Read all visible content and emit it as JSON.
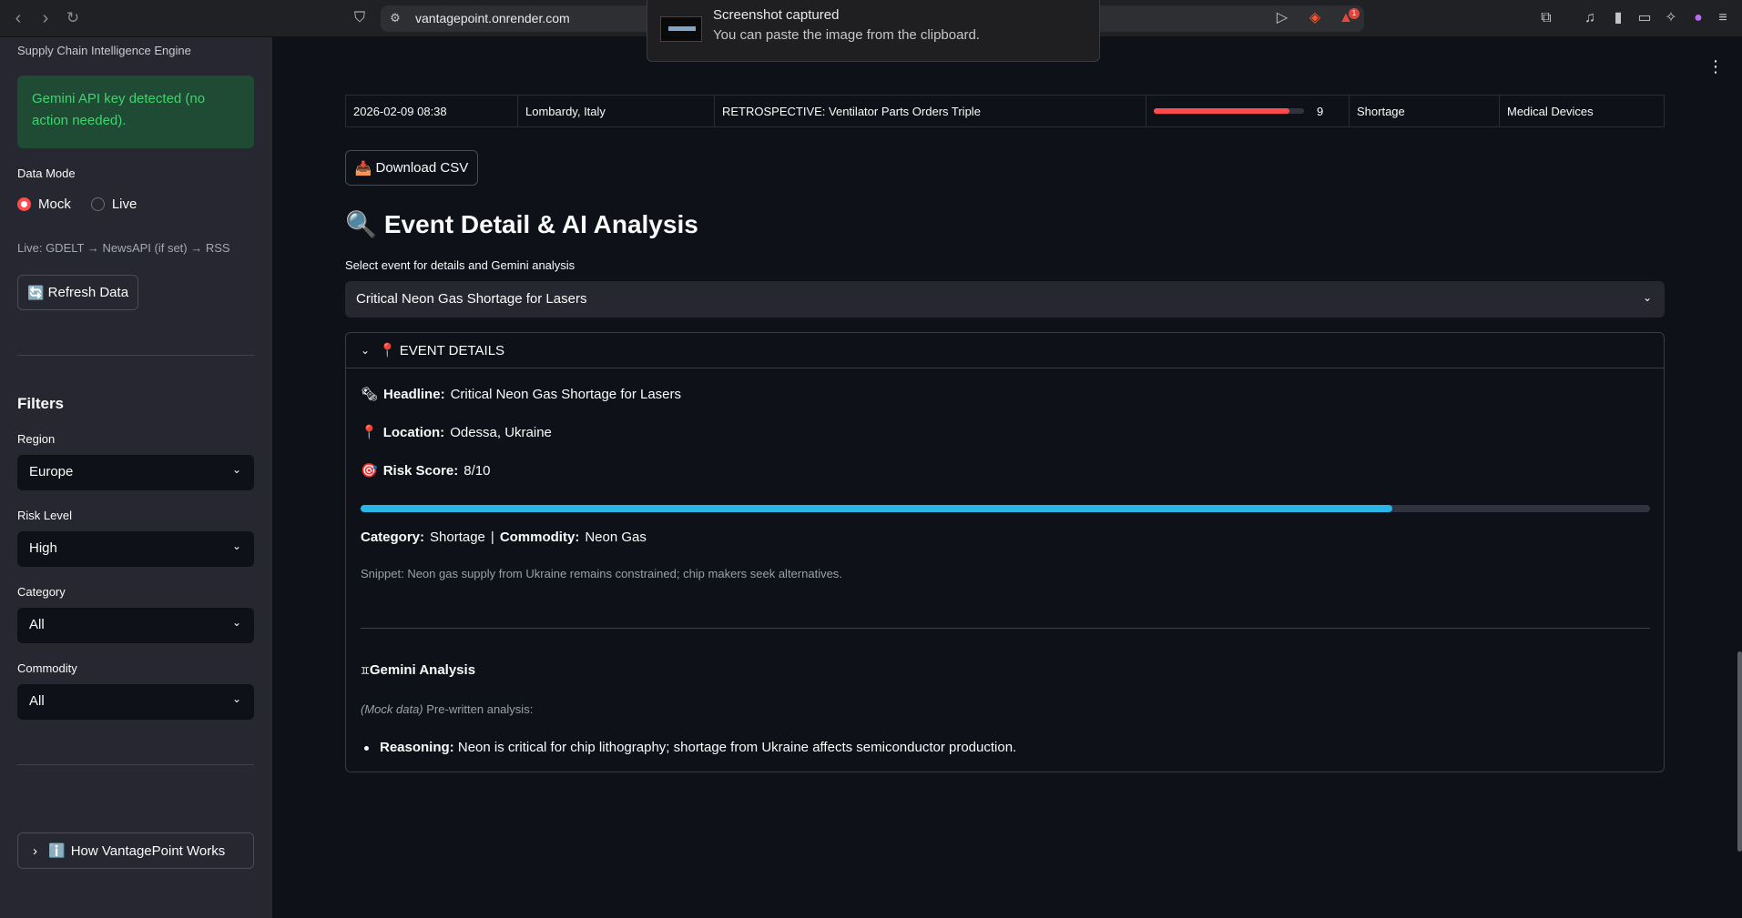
{
  "browser": {
    "url": "vantagepoint.onrender.com",
    "notification_count": "1"
  },
  "toast": {
    "title": "Screenshot captured",
    "subtitle": "You can paste the image from the clipboard."
  },
  "sidebar": {
    "tagline": "Supply Chain Intelligence Engine",
    "api_notice": "Gemini API key detected (no action needed).",
    "data_mode_label": "Data Mode",
    "mode_options": [
      "Mock",
      "Live"
    ],
    "mode_selected": "Mock",
    "live_caption": "Live: GDELT → NewsAPI (if set) → RSS",
    "refresh_icon": "🔄",
    "refresh_label": "Refresh Data",
    "filters_title": "Filters",
    "region_label": "Region",
    "region_value": "Europe",
    "risk_label": "Risk Level",
    "risk_value": "High",
    "category_label": "Category",
    "category_value": "All",
    "commodity_label": "Commodity",
    "commodity_value": "All",
    "how_icon": "ℹ️",
    "how_label": "How VantagePoint Works"
  },
  "table": {
    "row": {
      "timestamp": "2026-02-09 08:38",
      "location": "Lombardy, Italy",
      "headline": "RETROSPECTIVE: Ventilator Parts Orders Triple",
      "risk": 9,
      "risk_max": 10,
      "category": "Shortage",
      "commodity": "Medical Devices"
    }
  },
  "main": {
    "download_icon": "📥",
    "download_label": "Download CSV",
    "section_icon": "🔍",
    "section_title": "Event Detail & AI Analysis",
    "select_label": "Select event for details and Gemini analysis",
    "select_value": "Critical Neon Gas Shortage for Lasers"
  },
  "details": {
    "header_icon": "📍",
    "header": "EVENT DETAILS",
    "headline_icon": "🗞",
    "headline_label": "Headline:",
    "headline_value": "Critical Neon Gas Shortage for Lasers",
    "location_icon": "📍",
    "location_label": "Location:",
    "location_value": "Odessa, Ukraine",
    "risk_icon": "🎯",
    "risk_label": "Risk Score:",
    "risk_value": "8/10",
    "risk_fraction": 0.8,
    "category_label": "Category:",
    "category_value": "Shortage",
    "separator": "|",
    "commodity_label": "Commodity:",
    "commodity_value": "Neon Gas",
    "snippet": "Snippet: Neon gas supply from Ukraine remains constrained; chip makers seek alternatives."
  },
  "analysis": {
    "title_icon": "♊",
    "title": "Gemini Analysis",
    "mock_tag": "(Mock data)",
    "mock_text": "Pre-written analysis:",
    "reasoning_label": "Reasoning:",
    "reasoning_text": "Neon is critical for chip lithography; shortage from Ukraine affects semiconductor production."
  },
  "colors": {
    "accent_red": "#ff4b4b",
    "progress_blue": "#29b5e8",
    "success_green": "#3dd56d"
  }
}
